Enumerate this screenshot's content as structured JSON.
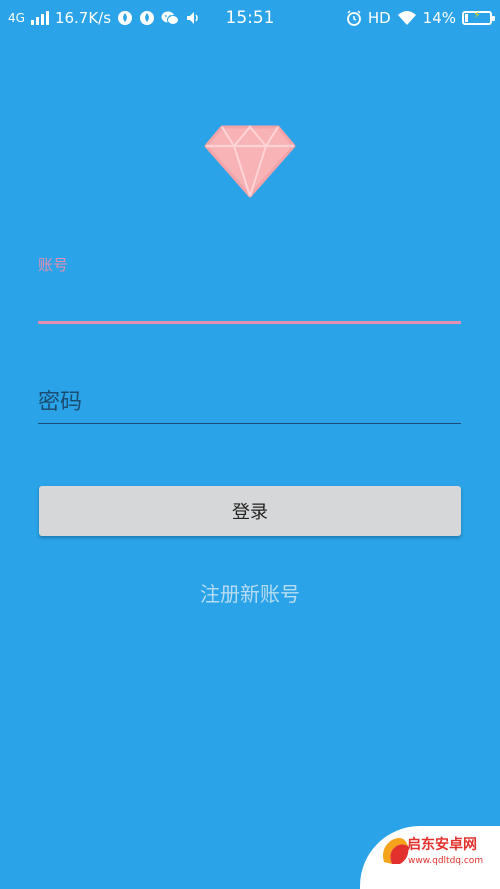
{
  "status_bar": {
    "network": "4G",
    "speed": "16.7K/s",
    "time": "15:51",
    "hd": "HD",
    "battery": "14%",
    "battery_level": 0.14,
    "icons": [
      "signal-icon",
      "app-notification-icon",
      "app-notification-icon",
      "wechat-icon",
      "volume-icon",
      "alarm-icon",
      "wifi-icon",
      "battery-charging-icon"
    ]
  },
  "logo": {
    "icon": "diamond-icon",
    "color": "#f4a3a8"
  },
  "account_field": {
    "label": "账号",
    "value": "",
    "accent_color": "#e58fb0"
  },
  "password_field": {
    "placeholder": "密码",
    "value": ""
  },
  "login_button": {
    "label": "登录"
  },
  "register_link": {
    "label": "注册新账号"
  },
  "watermark": {
    "title": "启东安卓网",
    "url": "www.qdltdq.com"
  },
  "colors": {
    "background": "#2aa3e8",
    "button_bg": "#d6d7d8",
    "register_text": "#b8dcf1",
    "password_underline": "#1c4e73"
  }
}
